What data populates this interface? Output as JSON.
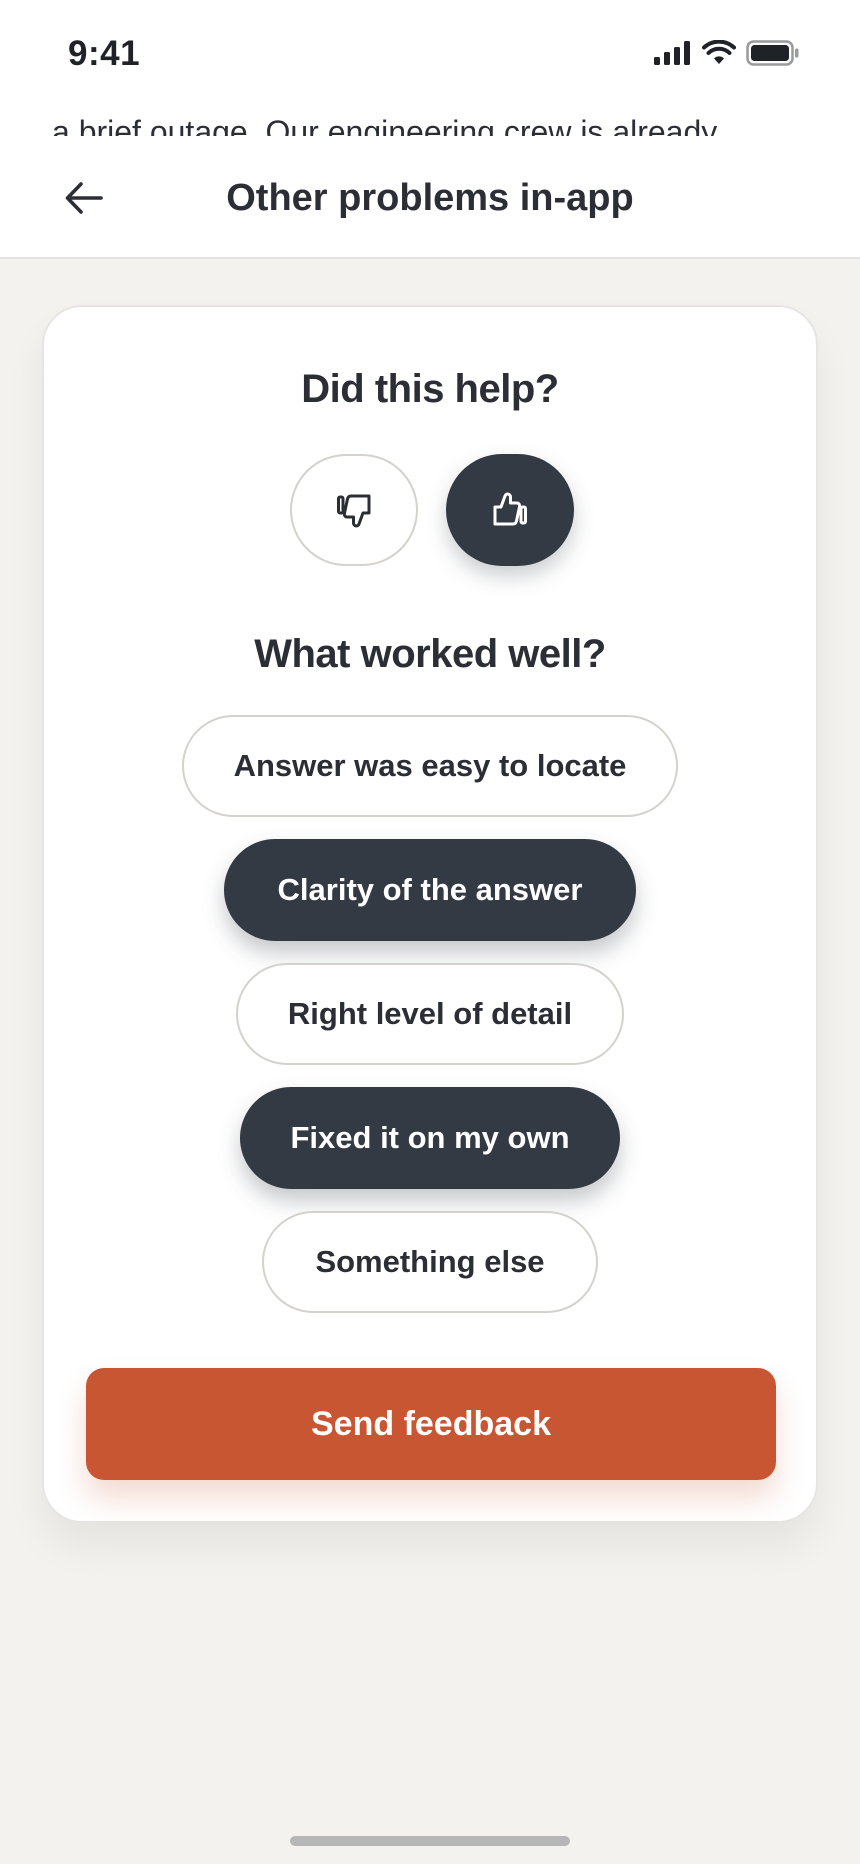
{
  "status_bar": {
    "time": "9:41"
  },
  "header": {
    "peek_text": "a brief outage. Our engineering crew is already",
    "title": "Other problems in-app"
  },
  "feedback": {
    "helpful_question": "Did this help?",
    "vote_selected": "thumbs-up",
    "follow_up_question": "What worked well?",
    "options": [
      {
        "label": "Answer was easy to locate",
        "selected": false
      },
      {
        "label": "Clarity of the answer",
        "selected": true
      },
      {
        "label": "Right level of detail",
        "selected": false
      },
      {
        "label": "Fixed it on my own",
        "selected": true
      },
      {
        "label": "Something else",
        "selected": false
      }
    ],
    "submit_label": "Send feedback"
  },
  "colors": {
    "accent": "#c95633",
    "selected": "#343a44",
    "background": "#f3f2ef"
  }
}
